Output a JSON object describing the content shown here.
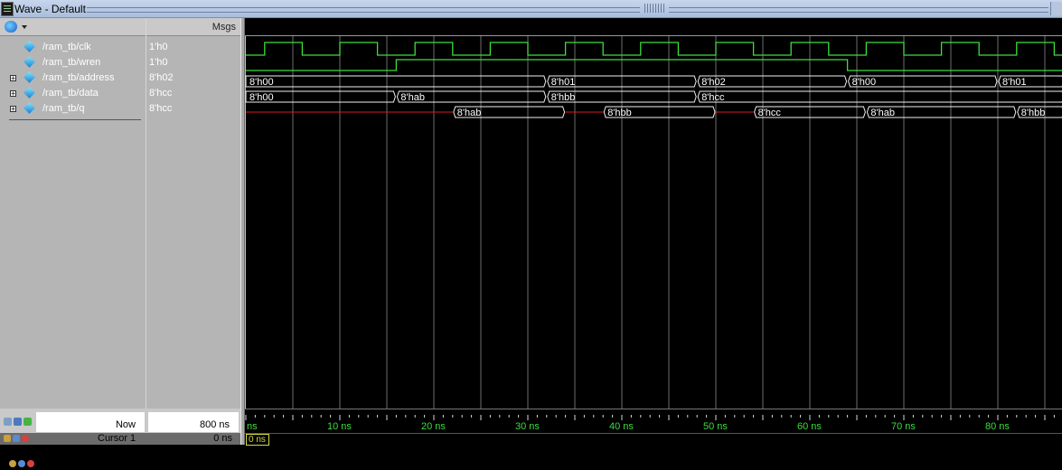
{
  "window": {
    "title": "Wave - Default"
  },
  "header": {
    "msgs_label": "Msgs"
  },
  "signals": [
    {
      "name": "/ram_tb/clk",
      "value": "1'h0",
      "expandable": false
    },
    {
      "name": "/ram_tb/wren",
      "value": "1'h0",
      "expandable": false
    },
    {
      "name": "/ram_tb/address",
      "value": "8'h02",
      "expandable": true
    },
    {
      "name": "/ram_tb/data",
      "value": "8'hcc",
      "expandable": true
    },
    {
      "name": "/ram_tb/q",
      "value": "8'hcc",
      "expandable": true
    }
  ],
  "waveform": {
    "clk_color": "#3ddc3d",
    "bus_color": "#f0f0f0",
    "undefined_color": "#e01818",
    "grid_color": "#8a8a8a",
    "wren_rise_ns": 16,
    "wren_fall_ns": 64,
    "address": [
      {
        "t": 0,
        "label": "8'h00"
      },
      {
        "t": 32,
        "label": "8'h01"
      },
      {
        "t": 48,
        "label": "8'h02"
      },
      {
        "t": 64,
        "label": "8'h00"
      },
      {
        "t": 80,
        "label": "8'h01"
      }
    ],
    "data": [
      {
        "t": 0,
        "label": "8'h00"
      },
      {
        "t": 16,
        "label": "8'hab"
      },
      {
        "t": 32,
        "label": "8'hbb"
      },
      {
        "t": 48,
        "label": "8'hcc"
      }
    ],
    "q": [
      {
        "t": 22,
        "t_end": 34,
        "label": "8'hab"
      },
      {
        "t": 38,
        "t_end": 50,
        "label": "8'hbb"
      },
      {
        "t": 54,
        "t_end": 66,
        "label": "8'hcc"
      },
      {
        "t": 66,
        "t_end": 82,
        "label": "8'hab"
      },
      {
        "t": 82,
        "t_end": 98,
        "label": "8'hbb"
      }
    ],
    "undefined_segments": [
      [
        0,
        22
      ],
      [
        34,
        38
      ],
      [
        50,
        54
      ]
    ]
  },
  "timeline": {
    "ticks": [
      {
        "ns": 0,
        "label": "ns"
      },
      {
        "ns": 10,
        "label": "10 ns"
      },
      {
        "ns": 20,
        "label": "20 ns"
      },
      {
        "ns": 30,
        "label": "30 ns"
      },
      {
        "ns": 40,
        "label": "40 ns"
      },
      {
        "ns": 50,
        "label": "50 ns"
      },
      {
        "ns": 60,
        "label": "60 ns"
      },
      {
        "ns": 70,
        "label": "70 ns"
      },
      {
        "ns": 80,
        "label": "80 ns"
      }
    ],
    "cursor_box_label": "0 ns"
  },
  "status": {
    "now_label": "Now",
    "now_value": "800 ns",
    "cursor_label": "Cursor 1",
    "cursor_value": "0 ns"
  }
}
